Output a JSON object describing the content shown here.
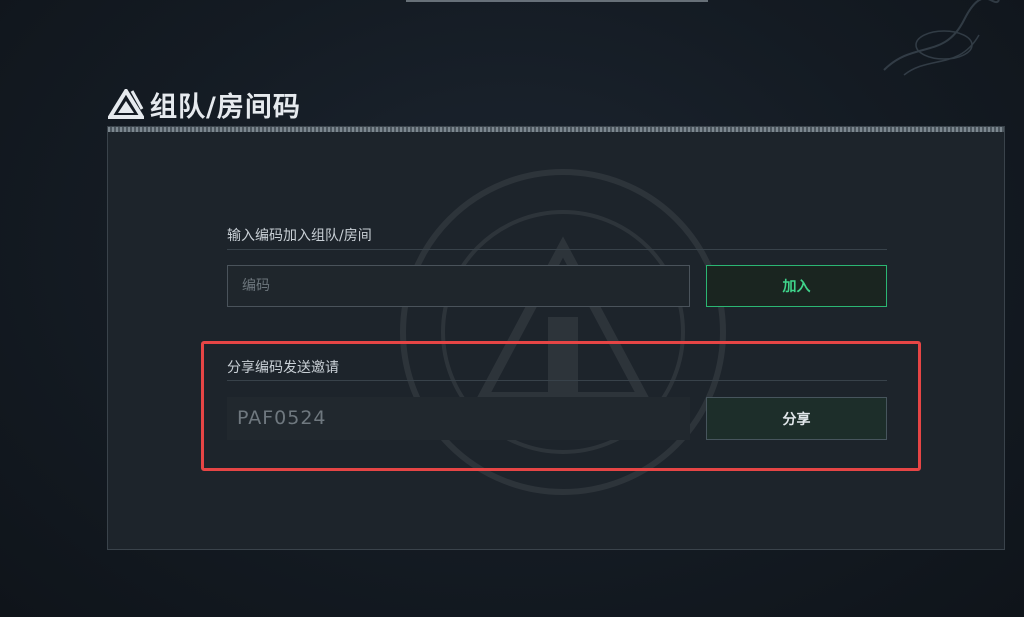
{
  "header": {
    "title": "组队/房间码"
  },
  "join_section": {
    "label": "输入编码加入组队/房间",
    "input_placeholder": "编码",
    "input_value": "",
    "join_button_label": "加入"
  },
  "share_section": {
    "label": "分享编码发送邀请",
    "code": "PAF0524",
    "share_button_label": "分享"
  },
  "colors": {
    "accent_green": "#2bb673",
    "highlight_red": "#e64545",
    "panel_background": "#1d242b"
  },
  "icons": {
    "logo": "triangle-logo-icon"
  }
}
